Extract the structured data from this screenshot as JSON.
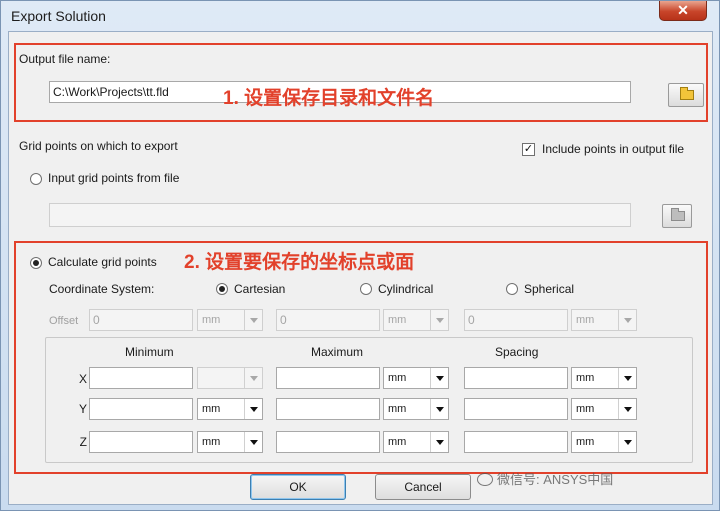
{
  "window": {
    "title": "Export Solution",
    "close_glyph": "✕"
  },
  "output": {
    "label": "Output file name:",
    "path": "C:\\Work\\Projects\\tt.fld",
    "browse_icon": "folder-icon"
  },
  "grid": {
    "section_label": "Grid points on which to export",
    "include_points_label": "Include points in output file",
    "include_points_checked": true,
    "input_option_label": "Input grid points from file",
    "input_file_value": "",
    "calculate_option_label": "Calculate grid points",
    "coord_system_label": "Coordinate System:",
    "coord_options": [
      "Cartesian",
      "Cylindrical",
      "Spherical"
    ],
    "coord_selected": "Cartesian",
    "offset_label": "Offset",
    "offset_values": [
      "0",
      "0",
      "0"
    ],
    "offset_units": [
      "mm",
      "mm",
      "mm"
    ],
    "columns": [
      "Minimum",
      "Maximum",
      "Spacing"
    ],
    "rows": [
      {
        "axis": "X",
        "min": "",
        "min_unit": "",
        "max": "",
        "max_unit": "mm",
        "spacing": "",
        "spacing_unit": "mm"
      },
      {
        "axis": "Y",
        "min": "",
        "min_unit": "mm",
        "max": "",
        "max_unit": "mm",
        "spacing": "",
        "spacing_unit": "mm"
      },
      {
        "axis": "Z",
        "min": "",
        "min_unit": "mm",
        "max": "",
        "max_unit": "mm",
        "spacing": "",
        "spacing_unit": "mm"
      }
    ]
  },
  "annotations": {
    "one": "1. 设置保存目录和文件名",
    "two": "2. 设置要保存的坐标点或面"
  },
  "buttons": {
    "ok": "OK",
    "cancel": "Cancel"
  },
  "watermark": "微信号: ANSYS中国",
  "colors": {
    "annotation": "#e2412b",
    "close_button": "#c8452a"
  }
}
